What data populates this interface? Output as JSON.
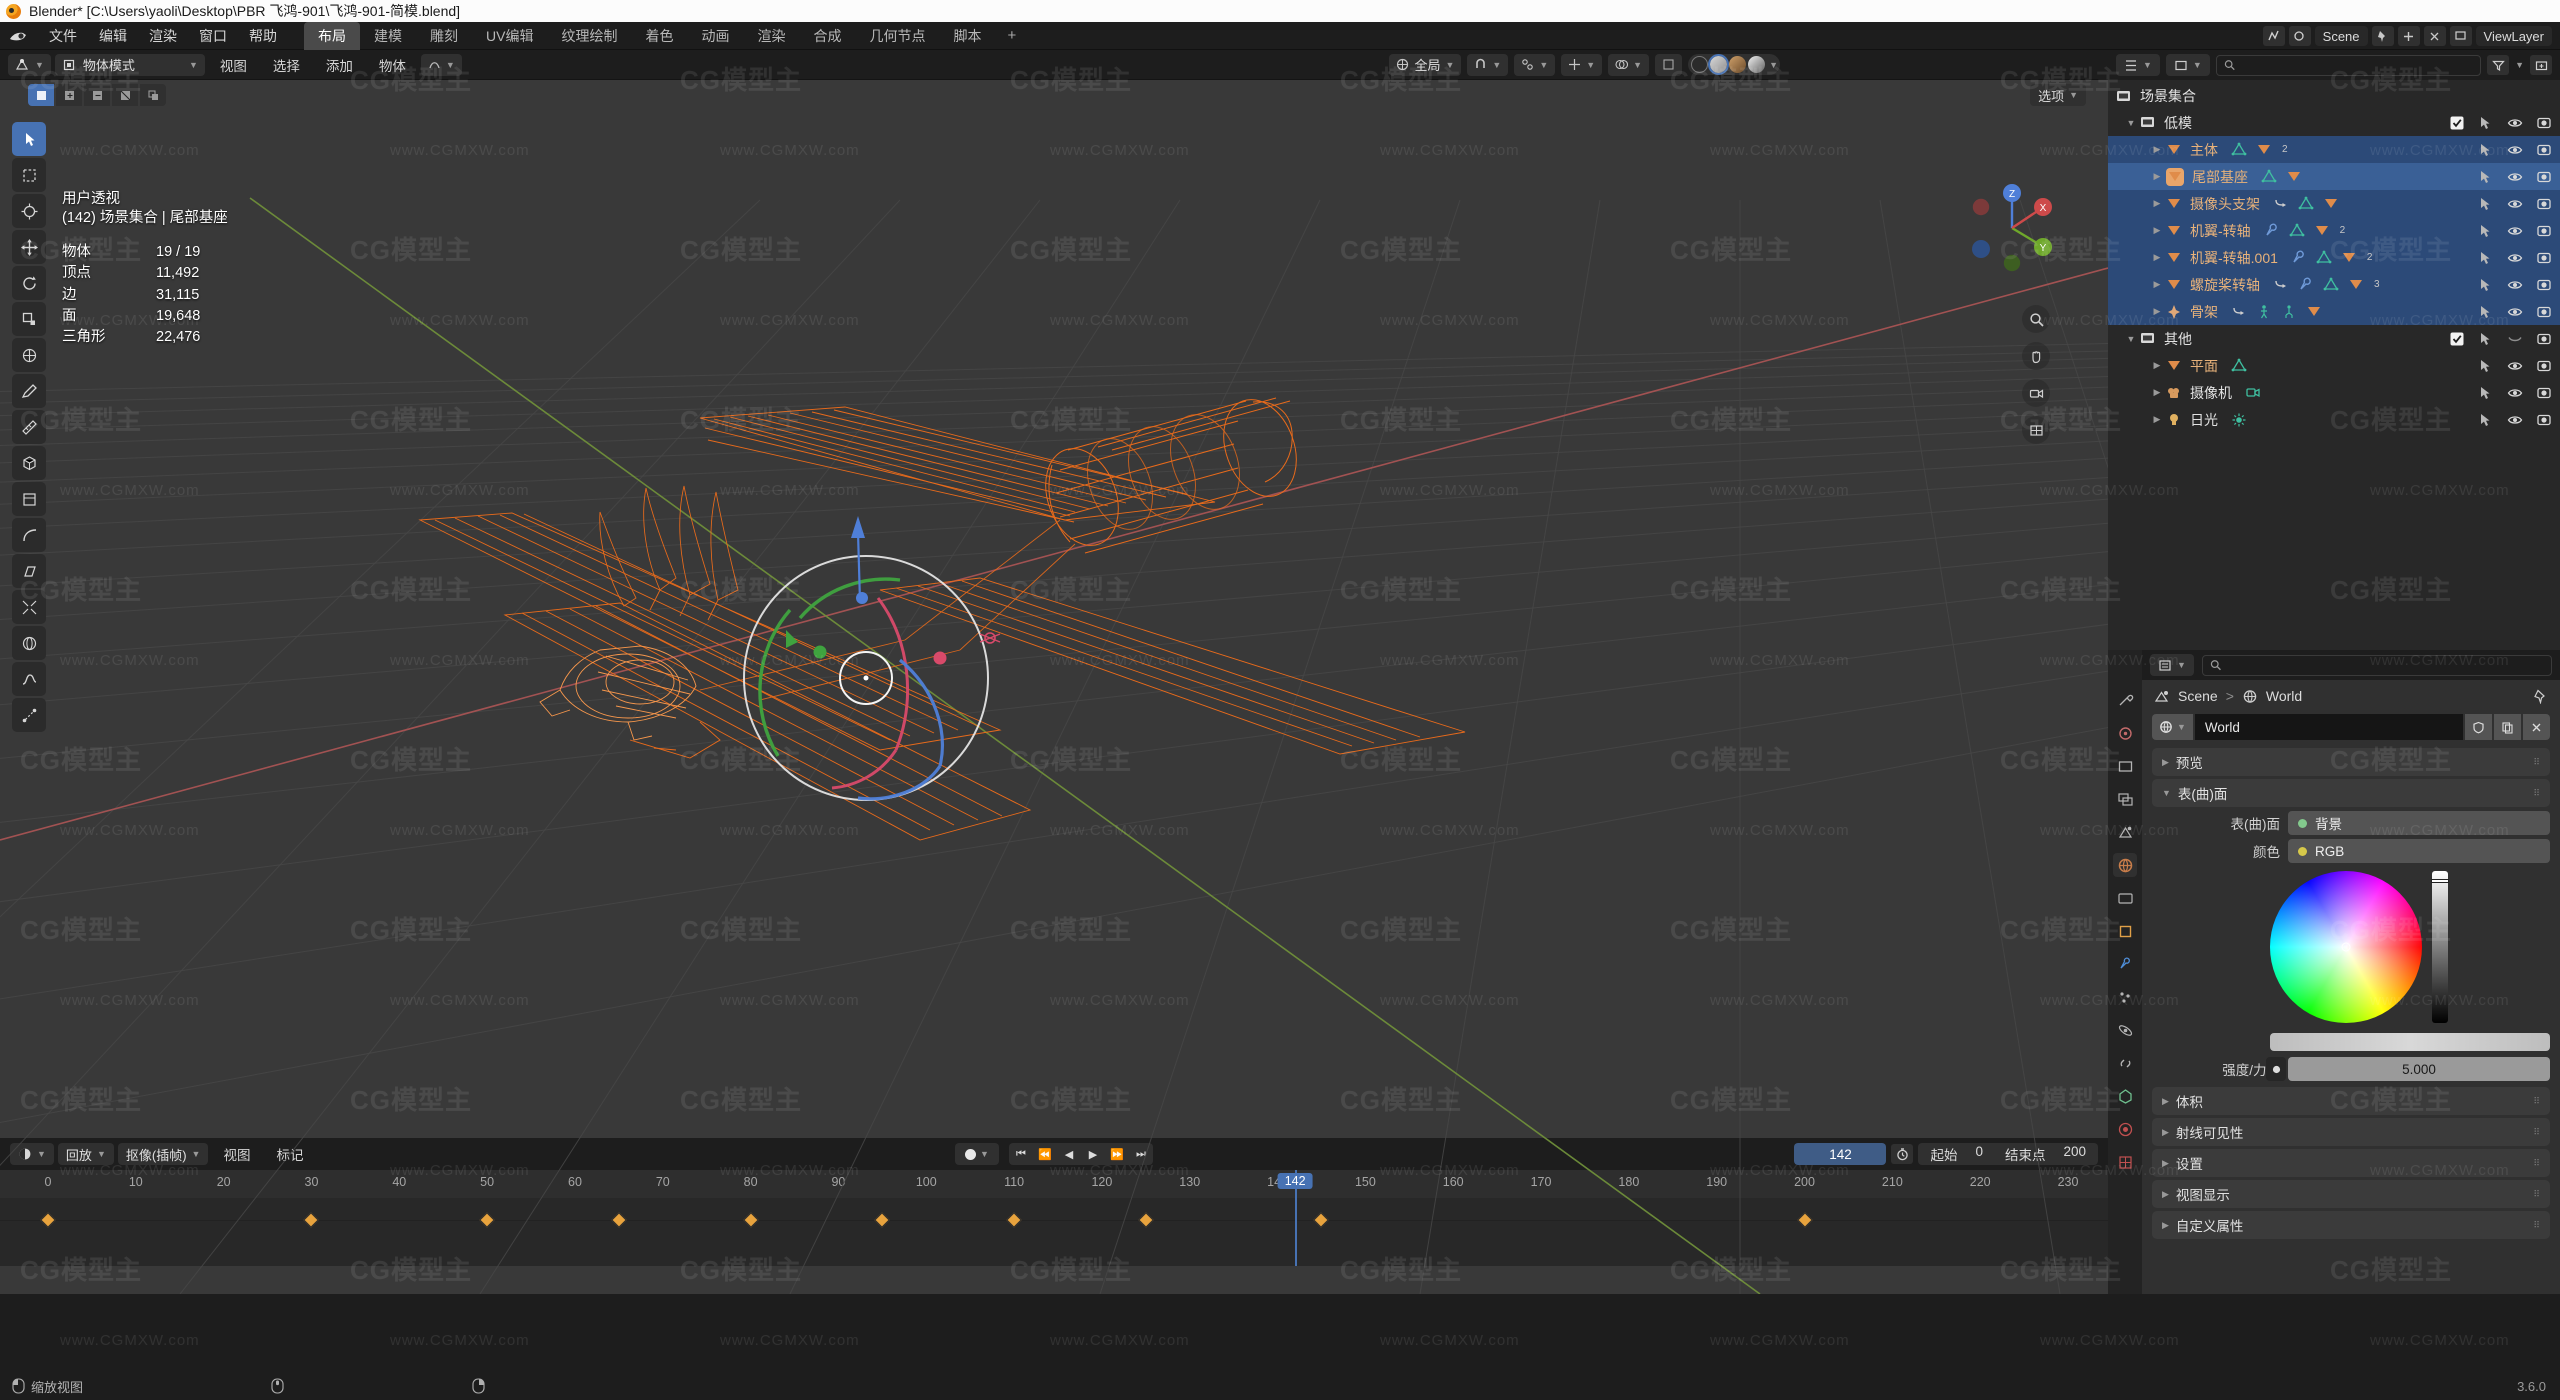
{
  "window": {
    "title": "Blender* [C:\\Users\\yaoli\\Desktop\\PBR 飞鸿-901\\飞鸿-901-简模.blend]",
    "version": "3.6.0"
  },
  "topbar": {
    "menus": [
      "文件",
      "编辑",
      "渲染",
      "窗口",
      "帮助"
    ],
    "workspaces": [
      "布局",
      "建模",
      "雕刻",
      "UV编辑",
      "纹理绘制",
      "着色",
      "动画",
      "渲染",
      "合成",
      "几何节点",
      "脚本"
    ],
    "active_workspace": "布局",
    "add_workspace": "+",
    "scene_name": "Scene",
    "viewlayer_name": "ViewLayer"
  },
  "viewport": {
    "mode": "物体模式",
    "menus": [
      "视图",
      "选择",
      "添加",
      "物体"
    ],
    "transform_orientation": "全局",
    "options_label": "选项",
    "stats": {
      "view_name": "用户透视",
      "context": "(142) 场景集合 | 尾部基座",
      "rows": [
        {
          "key": "物体",
          "value": "19 / 19"
        },
        {
          "key": "顶点",
          "value": "11,492"
        },
        {
          "key": "边",
          "value": "31,115"
        },
        {
          "key": "面",
          "value": "19,648"
        },
        {
          "key": "三角形",
          "value": "22,476"
        }
      ]
    },
    "gizmo_axes": {
      "x": "X",
      "y": "Y",
      "z": "Z"
    },
    "colors": {
      "selection_orange": "#f06d1a",
      "active_orange": "#ff9b4d",
      "axis_x_red": "#cd4a4a",
      "axis_y_green": "#6fa82b",
      "background": "#393939"
    }
  },
  "outliner": {
    "scene_collection": "场景集合",
    "search_placeholder": "",
    "items": [
      {
        "label": "低模",
        "type": "collection",
        "depth": 0,
        "expanded": true,
        "checkbox": true,
        "icons": [
          "filter",
          "eye",
          "camera"
        ],
        "midicons": []
      },
      {
        "label": "主体",
        "type": "object",
        "depth": 1,
        "selected": true,
        "midicons": [
          "mesh",
          "material"
        ],
        "count": "2"
      },
      {
        "label": "尾部基座",
        "type": "object",
        "depth": 1,
        "active": true,
        "midicons": [
          "mesh",
          "material"
        ],
        "count": ""
      },
      {
        "label": "摄像头支架",
        "type": "object",
        "depth": 1,
        "selected": true,
        "midicons": [
          "anim",
          "mesh",
          "material"
        ],
        "count": ""
      },
      {
        "label": "机翼-转轴",
        "type": "object",
        "depth": 1,
        "selected": true,
        "midicons": [
          "modifier",
          "mesh",
          "material"
        ],
        "count": "2"
      },
      {
        "label": "机翼-转轴.001",
        "type": "object",
        "depth": 1,
        "selected": true,
        "midicons": [
          "modifier",
          "mesh",
          "material"
        ],
        "count": "2"
      },
      {
        "label": "螺旋桨转轴",
        "type": "object",
        "depth": 1,
        "selected": true,
        "midicons": [
          "anim",
          "modifier",
          "mesh",
          "material"
        ],
        "count": "3"
      },
      {
        "label": "骨架",
        "type": "armature",
        "depth": 1,
        "selected": true,
        "midicons": [
          "anim",
          "pose",
          "armdata",
          "material"
        ],
        "count": ""
      },
      {
        "label": "其他",
        "type": "collection",
        "depth": 0,
        "expanded": true,
        "checkbox": true,
        "icons": [
          "filter",
          "hidden",
          "camera"
        ],
        "midicons": []
      },
      {
        "label": "平面",
        "type": "object",
        "depth": 1,
        "midicons": [
          "mesh"
        ],
        "count": ""
      },
      {
        "label": "摄像机",
        "type": "camera",
        "depth": 1,
        "midicons": [
          "camdata"
        ],
        "count": ""
      },
      {
        "label": "日光",
        "type": "light",
        "depth": 1,
        "midicons": [
          "lightdata"
        ],
        "count": ""
      }
    ]
  },
  "properties": {
    "search_placeholder": "",
    "breadcrumb": [
      "Scene",
      "World"
    ],
    "datablock_name": "World",
    "panels": [
      {
        "label": "预览",
        "open": false
      },
      {
        "label": "表(曲)面",
        "open": true
      },
      {
        "label": "体积",
        "open": false
      },
      {
        "label": "射线可见性",
        "open": false
      },
      {
        "label": "设置",
        "open": false
      },
      {
        "label": "视图显示",
        "open": false
      },
      {
        "label": "自定义属性",
        "open": false
      }
    ],
    "surface": {
      "surface_label": "表(曲)面",
      "surface_value": "背景",
      "color_label": "颜色",
      "color_value": "RGB",
      "strength_label": "强度/力度",
      "strength_value": "5.000"
    }
  },
  "timeline": {
    "dropdown_label": "回放",
    "keying_label": "抠像(插帧)",
    "menus": [
      "视图",
      "标记"
    ],
    "current_frame": "142",
    "start_label": "起始",
    "start_value": "0",
    "end_label": "结束点",
    "end_value": "200",
    "ruler_ticks": [
      "0",
      "10",
      "20",
      "30",
      "40",
      "50",
      "60",
      "70",
      "80",
      "90",
      "100",
      "110",
      "120",
      "130",
      "140",
      "150",
      "160",
      "170",
      "180",
      "190",
      "200",
      "210",
      "220",
      "230"
    ],
    "keyframes": [
      0,
      30,
      50,
      65,
      80,
      95,
      110,
      125,
      145,
      200
    ]
  },
  "statusbar": {
    "items": [
      {
        "icon": "mouse-left-icon",
        "label": "缩放视图"
      },
      {
        "icon": "mouse-middle-icon",
        "label": ""
      },
      {
        "icon": "mouse-right-icon",
        "label": ""
      }
    ],
    "version": "3.6.0"
  },
  "watermark": {
    "brand": "CG模型主",
    "url": "www.CGMXW.com"
  }
}
